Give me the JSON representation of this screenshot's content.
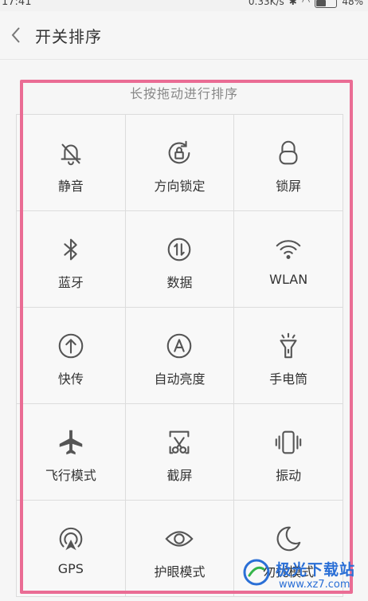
{
  "status_bar": {
    "time": "17:41",
    "network_speed": "0.33K/s",
    "battery": "48%"
  },
  "header": {
    "back_icon": "chevron-left-icon",
    "title": "开关排序"
  },
  "hint": "长按拖动进行排序",
  "tiles": [
    {
      "label": "静音",
      "icon": "bell-off-icon"
    },
    {
      "label": "方向锁定",
      "icon": "rotation-lock-icon"
    },
    {
      "label": "锁屏",
      "icon": "lock-icon"
    },
    {
      "label": "蓝牙",
      "icon": "bluetooth-icon"
    },
    {
      "label": "数据",
      "icon": "mobile-data-icon"
    },
    {
      "label": "WLAN",
      "icon": "wifi-icon"
    },
    {
      "label": "快传",
      "icon": "upload-arrow-icon"
    },
    {
      "label": "自动亮度",
      "icon": "auto-brightness-icon"
    },
    {
      "label": "手电筒",
      "icon": "flashlight-icon"
    },
    {
      "label": "飞行模式",
      "icon": "airplane-icon"
    },
    {
      "label": "截屏",
      "icon": "screenshot-icon"
    },
    {
      "label": "振动",
      "icon": "vibrate-icon"
    },
    {
      "label": "GPS",
      "icon": "gps-icon"
    },
    {
      "label": "护眼模式",
      "icon": "eye-icon"
    },
    {
      "label": "勿扰模式",
      "icon": "moon-icon"
    }
  ],
  "watermark": {
    "title": "极光下载站",
    "url": "www.xz7.com"
  },
  "colors": {
    "highlight_border": "#ea6c94",
    "watermark_blue": "#2a6fd6"
  }
}
